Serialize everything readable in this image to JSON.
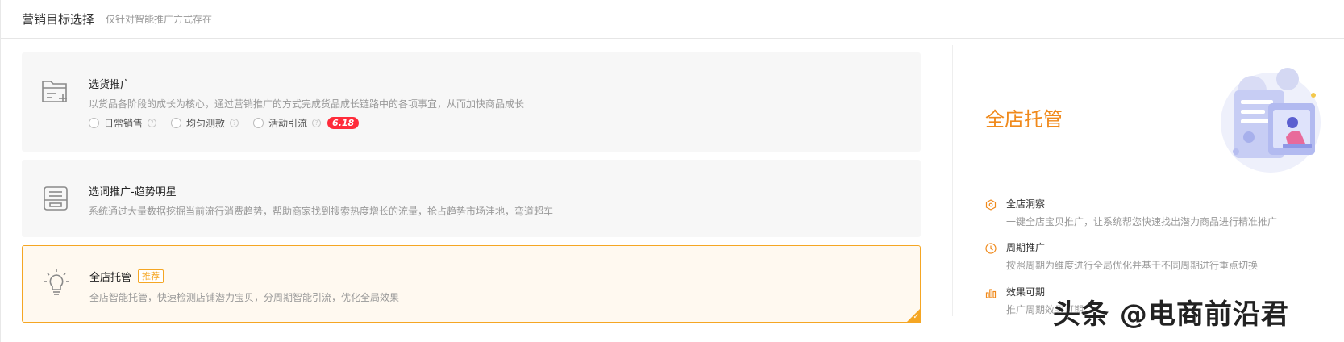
{
  "header": {
    "title": "营销目标选择",
    "subtitle": "仅针对智能推广方式存在"
  },
  "cards": [
    {
      "title": "选货推广",
      "desc": "以货品各阶段的成长为核心，通过营销推广的方式完成货品成长链路中的各项事宜，从而加快商品成长",
      "icon": "folder-add-icon",
      "options": [
        "日常销售",
        "均匀测款",
        "活动引流"
      ],
      "promo_tag": "6.18"
    },
    {
      "title": "选词推广-趋势明星",
      "desc": "系统通过大量数据挖掘当前流行消费趋势，帮助商家找到搜索热度增长的流量，抢占趋势市场洼地，弯道超车",
      "icon": "inbox-icon"
    },
    {
      "title": "全店托管",
      "badge": "推荐",
      "desc": "全店智能托管，快速检测店铺潜力宝贝，分周期智能引流，优化全局效果",
      "icon": "lightbulb-icon",
      "selected": true
    }
  ],
  "right_panel": {
    "title": "全店托管",
    "features": [
      {
        "name": "全店洞察",
        "desc": "一键全店宝贝推广，让系统帮您快速找出潜力商品进行精准推广",
        "icon": "cube-icon"
      },
      {
        "name": "周期推广",
        "desc": "按照周期为维度进行全局优化并基于不同周期进行重点切换",
        "icon": "clock-icon"
      },
      {
        "name": "效果可期",
        "desc": "推广周期效果可期",
        "icon": "bar-chart-icon"
      }
    ]
  },
  "watermark": "头条 @电商前沿君",
  "colors": {
    "accent": "#f08a1c",
    "selected_border": "#f5a623",
    "promo_red": "#ff2b3a"
  }
}
